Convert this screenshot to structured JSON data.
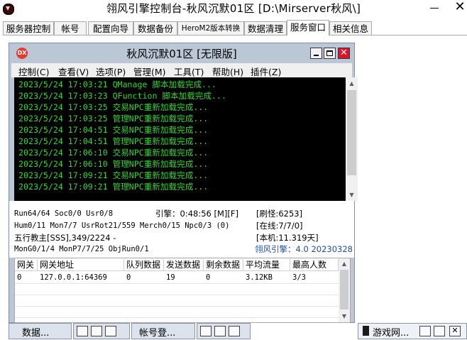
{
  "window": {
    "title": "翎风引擎控制台-秋风沉默01区 [D:\\Mirserver秋风\\]",
    "close_glyph": "✕"
  },
  "tabs": [
    {
      "label": "服务器控制"
    },
    {
      "label": "帐号"
    },
    {
      "label": "配置向导"
    },
    {
      "label": "数据备份"
    },
    {
      "label": "HeroM2版本转换"
    },
    {
      "label": "数据清理"
    },
    {
      "label": "服务窗口"
    },
    {
      "label": "相关信息"
    }
  ],
  "inner_window": {
    "icon_text": "DX",
    "title": "秋风沉默01区 [无限版]",
    "close_glyph": "✕",
    "accent_color": "#e81123",
    "menu": [
      {
        "label": "控制(C)"
      },
      {
        "label": "查看(V)"
      },
      {
        "label": "选项(P)"
      },
      {
        "label": "管理(M)"
      },
      {
        "label": "工具(T)"
      },
      {
        "label": "帮助(H)"
      },
      {
        "label": "插件(Z)"
      }
    ]
  },
  "console": {
    "text_color": "#35d435",
    "lines": [
      "2023/5/24 17:03:21 QManage 脚本加载完成...",
      "2023/5/24 17:03:23 QFunction 脚本加载完成...",
      "2023/5/24 17:03:25 交易NPC重新加载完成...",
      "2023/5/24 17:03:25 管理NPC重新加载完成...",
      "2023/5/24 17:04:51 交易NPC重新加载完成...",
      "2023/5/24 17:04:51 管理NPC重新加载完成...",
      "2023/5/24 17:06:10 交易NPC重新加载完成...",
      "2023/5/24 17:06:10 管理NPC重新加载完成...",
      "2023/5/24 17:09:21 交易NPC重新加载完成...",
      "2023/5/24 17:09:21 管理NPC重新加载完成..."
    ]
  },
  "status": {
    "run": "Run64/64 Soc0/0 Usr0/8",
    "engine_time": "引擎：0:48:56 [M][F]",
    "refresh": "[刷怪:6253]",
    "hum": "Hum0/11 Mon7/7 UsrRot21/559 Merch0/15 Npc0/3 (0)",
    "online": "[在线:7/7/0]",
    "leader": "五行教主[SSS],349/2224 -",
    "uptime": "[本机:11.319天]",
    "mon": "MonG0/1/4 MonP7/7/25 ObjRun0/1",
    "version": "翎风引擎：4.0 20230328"
  },
  "gateway_table": {
    "columns": [
      "网关",
      "网关地址",
      "队列数据",
      "发送数据",
      "剩余数据",
      "平均流量",
      "最高人数"
    ],
    "rows": [
      [
        "0",
        "127.0.0.1:64369",
        "0",
        "19",
        "0",
        "3.12KB",
        "3/3"
      ]
    ]
  },
  "minimized_windows": [
    {
      "title": "数据..."
    },
    {
      "title": "帐号登..."
    },
    {
      "title": "游戏网..."
    }
  ]
}
